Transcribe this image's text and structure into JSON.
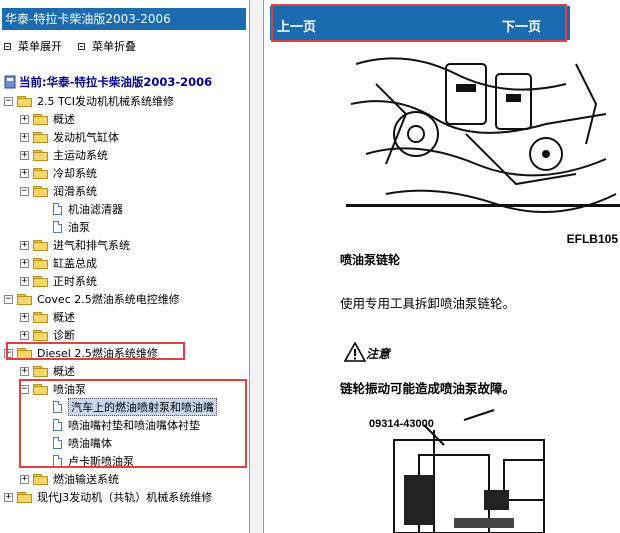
{
  "left_panel": {
    "title": "华泰-特拉卡柴油版2003-2006",
    "expand_all": "菜单展开",
    "collapse_all": "菜单折叠",
    "current": "当前:华泰-特拉卡柴油版2003-2006"
  },
  "tree": {
    "n0": "2.5 TCI发动机机械系统维修",
    "n0_0": "概述",
    "n0_1": "发动机气缸体",
    "n0_2": "主运动系统",
    "n0_3": "冷却系统",
    "n0_4": "润滑系统",
    "n0_4_0": "机油滤清器",
    "n0_4_1": "油泵",
    "n0_5": "进气和排气系统",
    "n0_6": "缸盖总成",
    "n0_7": "正时系统",
    "n1": "Covec 2.5燃油系统电控维修",
    "n1_0": "概述",
    "n1_1": "诊断",
    "n2": "Diesel 2.5燃油系统维修",
    "n2_0": "概述",
    "n2_1": "喷油泵",
    "n2_1_0": "汽车上的燃油喷射泵和喷油嘴",
    "n2_1_1": "喷油嘴衬垫和喷油嘴体衬垫",
    "n2_1_2": "喷油嘴体",
    "n2_1_3": "卢卡斯喷油泵",
    "n2_2": "燃油输送系统",
    "n3": "现代J3发动机（共轨）机械系统维修"
  },
  "nav": {
    "prev": "上一页",
    "next": "下一页"
  },
  "content": {
    "figure_code": "EFLB105",
    "heading": "喷油泵链轮",
    "body": "使用专用工具拆卸喷油泵链轮。",
    "caution_label": "注意",
    "caution_text": "链轮振动可能造成喷油泵故障。",
    "tool_code": "09314-43000"
  },
  "colors": {
    "title_bar": "#1a6bb0",
    "highlight_box": "#e04040",
    "selection": "#c9d8ee"
  }
}
